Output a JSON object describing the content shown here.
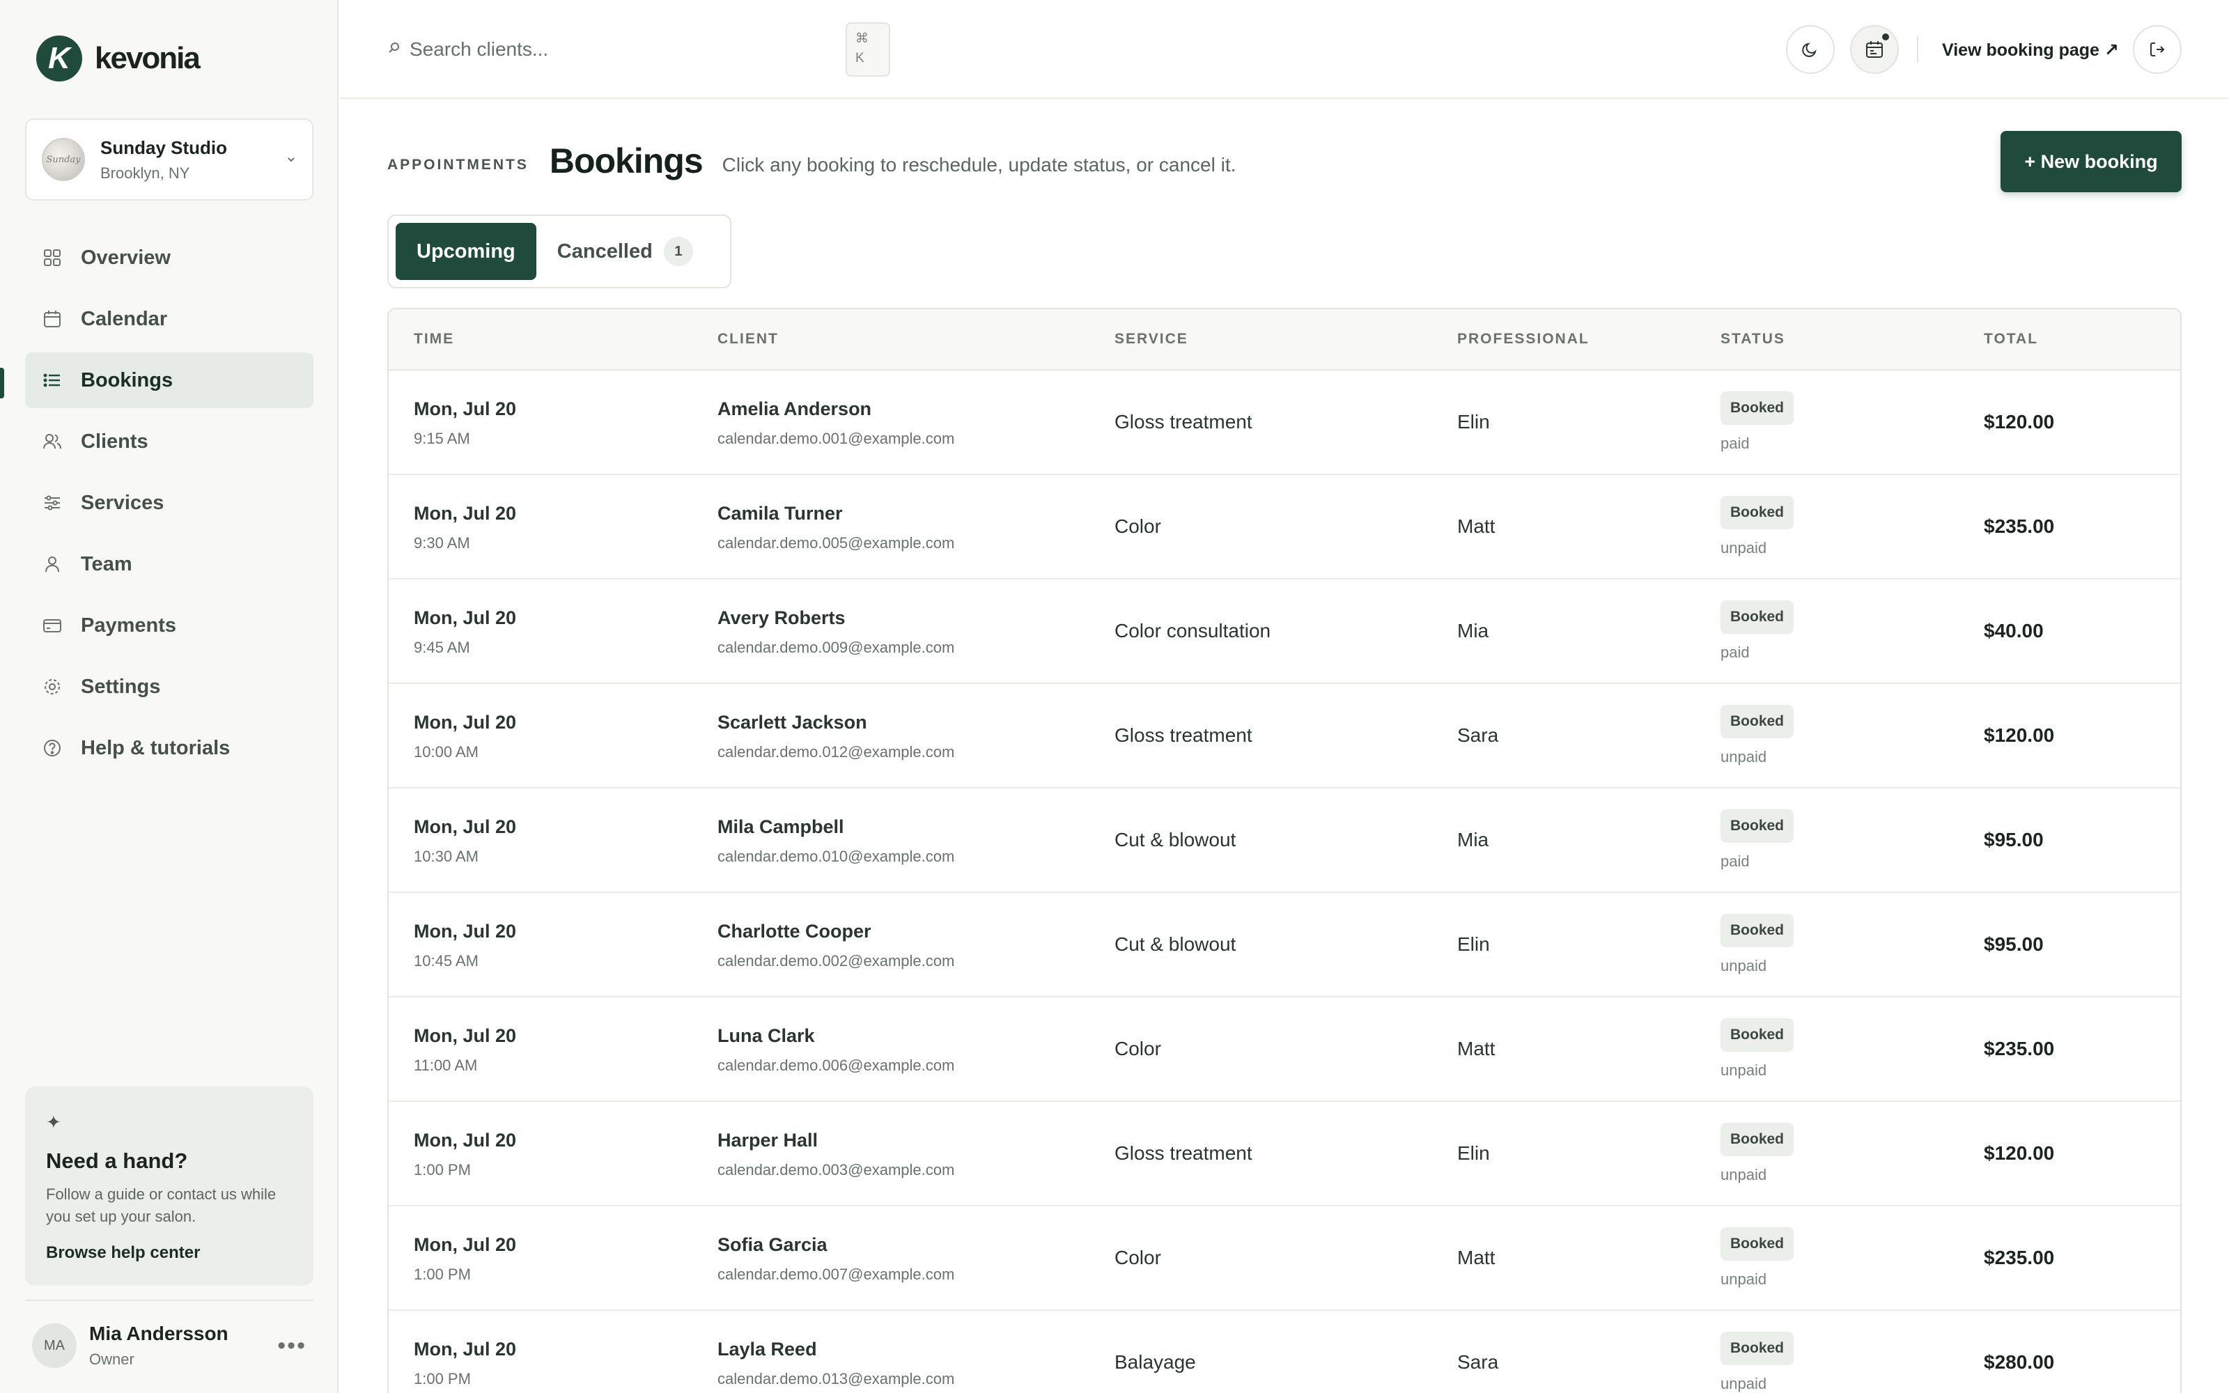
{
  "brand": {
    "name": "kevonia",
    "mark": "K"
  },
  "studio": {
    "name": "Sunday Studio",
    "location": "Brooklyn, NY",
    "avatar_text": "Sunday"
  },
  "nav": [
    {
      "label": "Overview",
      "icon": "grid-icon",
      "active": false
    },
    {
      "label": "Calendar",
      "icon": "calendar-icon",
      "active": false
    },
    {
      "label": "Bookings",
      "icon": "list-icon",
      "active": true
    },
    {
      "label": "Clients",
      "icon": "users-icon",
      "active": false
    },
    {
      "label": "Services",
      "icon": "sliders-icon",
      "active": false
    },
    {
      "label": "Team",
      "icon": "person-icon",
      "active": false
    },
    {
      "label": "Payments",
      "icon": "card-icon",
      "active": false
    },
    {
      "label": "Settings",
      "icon": "gear-icon",
      "active": false
    },
    {
      "label": "Help & tutorials",
      "icon": "help-icon",
      "active": false
    }
  ],
  "help": {
    "title": "Need a hand?",
    "description": "Follow a guide or contact us while you set up your salon.",
    "link": "Browse help center"
  },
  "user": {
    "initials": "MA",
    "name": "Mia Andersson",
    "role": "Owner"
  },
  "topbar": {
    "search_placeholder": "Search clients...",
    "kbd_symbol": "⌘",
    "kbd_key": "K",
    "view_booking_label": "View booking page ↗"
  },
  "page": {
    "eyebrow": "APPOINTMENTS",
    "title": "Bookings",
    "subtitle": "Click any booking to reschedule, update status, or cancel it.",
    "new_booking_label": "+ New booking"
  },
  "tabs": [
    {
      "label": "Upcoming",
      "active": true,
      "count": null
    },
    {
      "label": "Cancelled",
      "active": false,
      "count": "1"
    }
  ],
  "table": {
    "columns": [
      "TIME",
      "CLIENT",
      "SERVICE",
      "PROFESSIONAL",
      "STATUS",
      "TOTAL"
    ],
    "rows": [
      {
        "date": "Mon, Jul 20",
        "time": "9:15 AM",
        "client": "Amelia Anderson",
        "email": "calendar.demo.001@example.com",
        "service": "Gloss treatment",
        "professional": "Elin",
        "status": "Booked",
        "payment": "paid",
        "total": "$120.00"
      },
      {
        "date": "Mon, Jul 20",
        "time": "9:30 AM",
        "client": "Camila Turner",
        "email": "calendar.demo.005@example.com",
        "service": "Color",
        "professional": "Matt",
        "status": "Booked",
        "payment": "unpaid",
        "total": "$235.00"
      },
      {
        "date": "Mon, Jul 20",
        "time": "9:45 AM",
        "client": "Avery Roberts",
        "email": "calendar.demo.009@example.com",
        "service": "Color consultation",
        "professional": "Mia",
        "status": "Booked",
        "payment": "paid",
        "total": "$40.00"
      },
      {
        "date": "Mon, Jul 20",
        "time": "10:00 AM",
        "client": "Scarlett Jackson",
        "email": "calendar.demo.012@example.com",
        "service": "Gloss treatment",
        "professional": "Sara",
        "status": "Booked",
        "payment": "unpaid",
        "total": "$120.00"
      },
      {
        "date": "Mon, Jul 20",
        "time": "10:30 AM",
        "client": "Mila Campbell",
        "email": "calendar.demo.010@example.com",
        "service": "Cut & blowout",
        "professional": "Mia",
        "status": "Booked",
        "payment": "paid",
        "total": "$95.00"
      },
      {
        "date": "Mon, Jul 20",
        "time": "10:45 AM",
        "client": "Charlotte Cooper",
        "email": "calendar.demo.002@example.com",
        "service": "Cut & blowout",
        "professional": "Elin",
        "status": "Booked",
        "payment": "unpaid",
        "total": "$95.00"
      },
      {
        "date": "Mon, Jul 20",
        "time": "11:00 AM",
        "client": "Luna Clark",
        "email": "calendar.demo.006@example.com",
        "service": "Color",
        "professional": "Matt",
        "status": "Booked",
        "payment": "unpaid",
        "total": "$235.00"
      },
      {
        "date": "Mon, Jul 20",
        "time": "1:00 PM",
        "client": "Harper Hall",
        "email": "calendar.demo.003@example.com",
        "service": "Gloss treatment",
        "professional": "Elin",
        "status": "Booked",
        "payment": "unpaid",
        "total": "$120.00"
      },
      {
        "date": "Mon, Jul 20",
        "time": "1:00 PM",
        "client": "Sofia Garcia",
        "email": "calendar.demo.007@example.com",
        "service": "Color",
        "professional": "Matt",
        "status": "Booked",
        "payment": "unpaid",
        "total": "$235.00"
      },
      {
        "date": "Mon, Jul 20",
        "time": "1:00 PM",
        "client": "Layla Reed",
        "email": "calendar.demo.013@example.com",
        "service": "Balayage",
        "professional": "Sara",
        "status": "Booked",
        "payment": "unpaid",
        "total": "$280.00"
      }
    ]
  },
  "colors": {
    "accent": "#1f4a3c",
    "badge_bg": "#eceeeb",
    "sidebar_bg": "#f8f8f6"
  }
}
